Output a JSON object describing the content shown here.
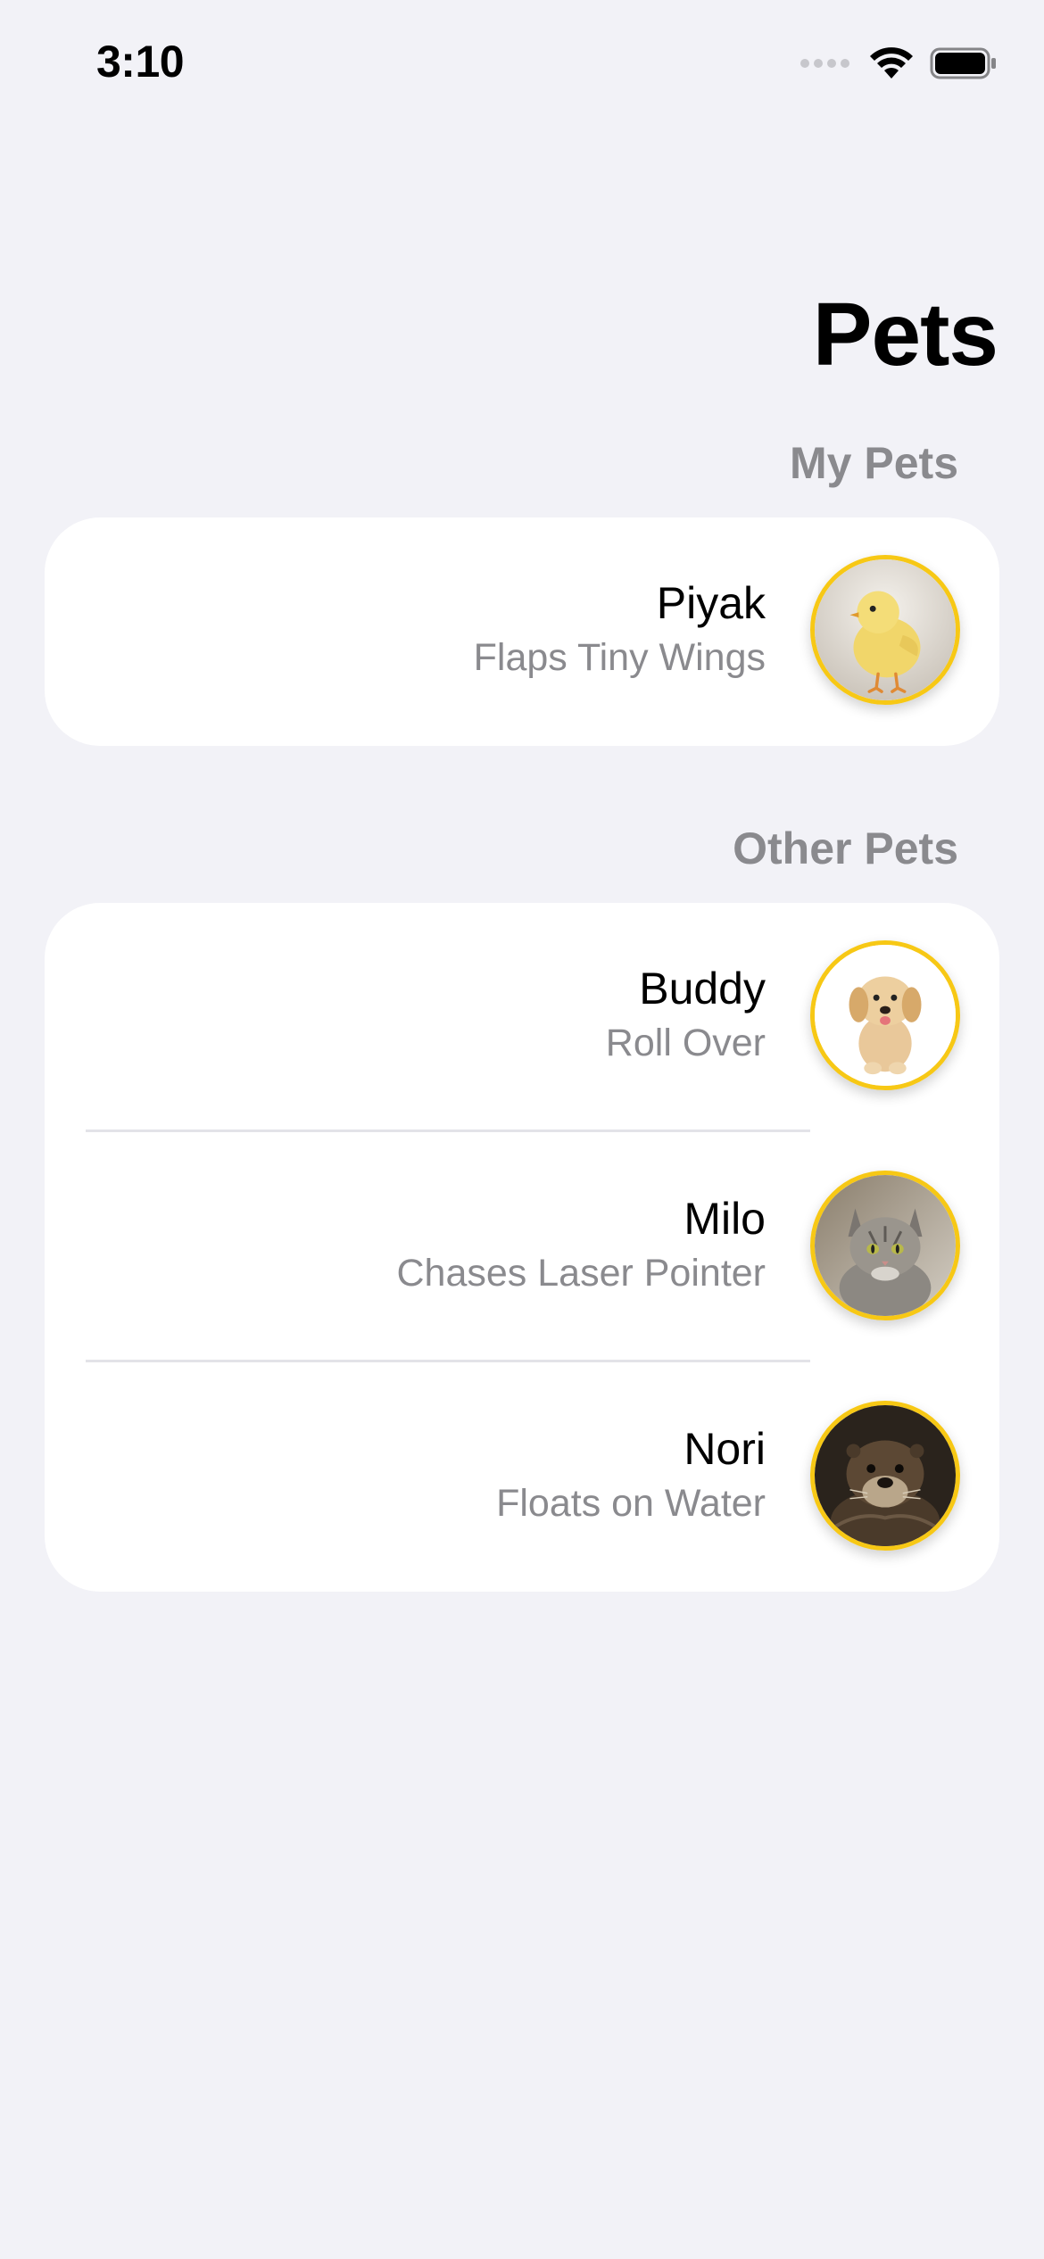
{
  "status_bar": {
    "time": "3:10",
    "icons": [
      "cellular-signal-icon",
      "wifi-icon",
      "battery-icon"
    ]
  },
  "title": "Pets",
  "sections": [
    {
      "header": "My Pets",
      "rows": [
        {
          "name": "Piyak",
          "subtitle": "Flaps Tiny Wings",
          "avatar": "chick-photo"
        }
      ]
    },
    {
      "header": "Other Pets",
      "rows": [
        {
          "name": "Buddy",
          "subtitle": "Roll Over",
          "avatar": "puppy-photo"
        },
        {
          "name": "Milo",
          "subtitle": "Chases Laser Pointer",
          "avatar": "cat-photo"
        },
        {
          "name": "Nori",
          "subtitle": "Floats on Water",
          "avatar": "otter-photo"
        }
      ]
    }
  ],
  "colors": {
    "background": "#f2f2f7",
    "card": "#ffffff",
    "avatar_border": "#f7c815",
    "secondary_text": "#8a8a8e"
  }
}
